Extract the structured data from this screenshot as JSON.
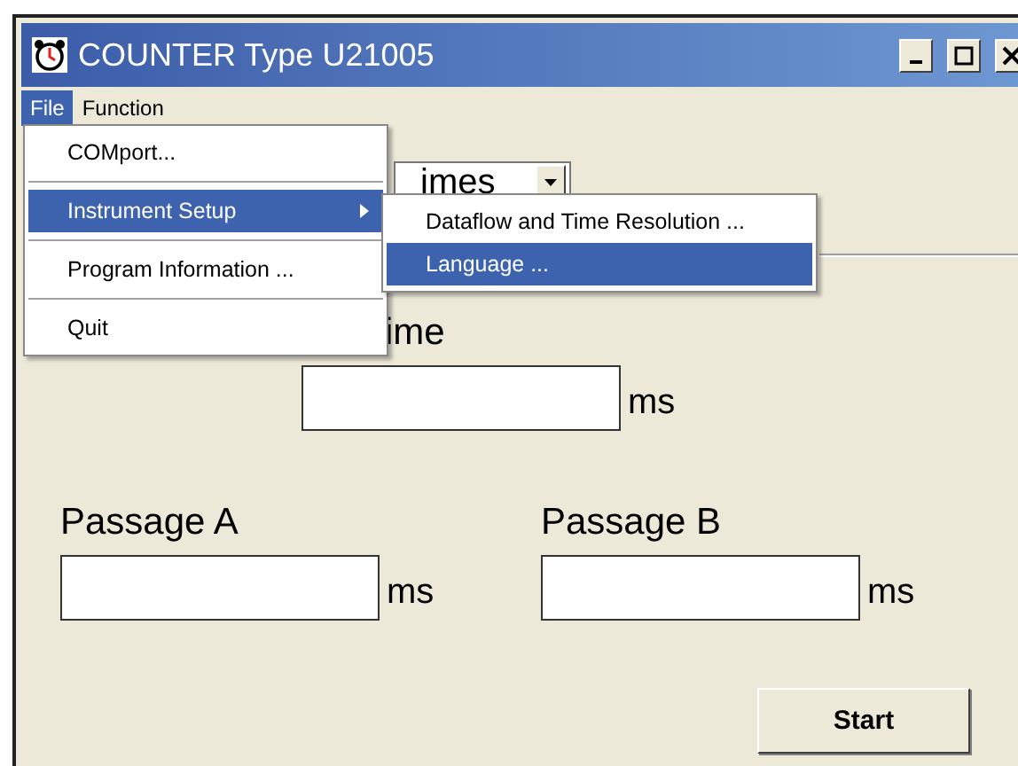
{
  "window": {
    "title": "COUNTER Type U21005"
  },
  "menu_bar": [
    {
      "label": "File",
      "selected": true
    },
    {
      "label": "Function",
      "selected": false
    }
  ],
  "file_menu": [
    {
      "kind": "item",
      "label": "COMport...",
      "selected": false,
      "submenu": false
    },
    {
      "kind": "separator"
    },
    {
      "kind": "item",
      "label": "Instrument Setup",
      "selected": true,
      "submenu": true
    },
    {
      "kind": "separator"
    },
    {
      "kind": "item",
      "label": "Program Information ...",
      "selected": false,
      "submenu": false
    },
    {
      "kind": "separator"
    },
    {
      "kind": "item",
      "label": "Quit",
      "selected": false,
      "submenu": false
    }
  ],
  "submenu": [
    {
      "label": "Dataflow and Time Resolution ...",
      "selected": false
    },
    {
      "label": "Language ...",
      "selected": true
    }
  ],
  "mode_select": {
    "value": "imes"
  },
  "time": {
    "label": "ime",
    "unit": "ms"
  },
  "passages": [
    {
      "label": "Passage A",
      "unit": "ms"
    },
    {
      "label": "Passage B",
      "unit": "ms"
    }
  ],
  "start_button": "Start"
}
